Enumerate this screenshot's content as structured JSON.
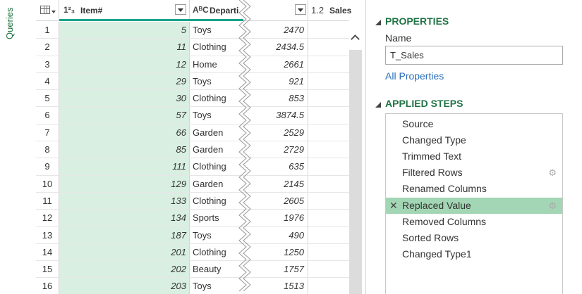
{
  "queries_rail": {
    "label": "Queries"
  },
  "grid": {
    "headers": {
      "item": {
        "type_icon": "1²₃",
        "label": "Item#"
      },
      "dept": {
        "type_icon": "AᴮC",
        "label": "Departi"
      },
      "sales": {
        "type_icon": "1.2",
        "label": "Sales"
      }
    },
    "rows": [
      {
        "n": "1",
        "item": "5",
        "dept": "Toys",
        "sales": "2470"
      },
      {
        "n": "2",
        "item": "11",
        "dept": "Clothing",
        "sales": "2434.5"
      },
      {
        "n": "3",
        "item": "12",
        "dept": "Home",
        "sales": "2661"
      },
      {
        "n": "4",
        "item": "29",
        "dept": "Toys",
        "sales": "921"
      },
      {
        "n": "5",
        "item": "30",
        "dept": "Clothing",
        "sales": "853"
      },
      {
        "n": "6",
        "item": "57",
        "dept": "Toys",
        "sales": "3874.5"
      },
      {
        "n": "7",
        "item": "66",
        "dept": "Garden",
        "sales": "2529"
      },
      {
        "n": "8",
        "item": "85",
        "dept": "Garden",
        "sales": "2729"
      },
      {
        "n": "9",
        "item": "111",
        "dept": "Clothing",
        "sales": "635"
      },
      {
        "n": "10",
        "item": "129",
        "dept": "Garden",
        "sales": "2145"
      },
      {
        "n": "11",
        "item": "133",
        "dept": "Clothing",
        "sales": "2605"
      },
      {
        "n": "12",
        "item": "134",
        "dept": "Sports",
        "sales": "1976"
      },
      {
        "n": "13",
        "item": "187",
        "dept": "Toys",
        "sales": "490"
      },
      {
        "n": "14",
        "item": "201",
        "dept": "Clothing",
        "sales": "1250"
      },
      {
        "n": "15",
        "item": "202",
        "dept": "Beauty",
        "sales": "1757"
      },
      {
        "n": "16",
        "item": "203",
        "dept": "Toys",
        "sales": "1513"
      }
    ]
  },
  "properties": {
    "title": "PROPERTIES",
    "name_label": "Name",
    "name_value": "T_Sales",
    "all_properties_link": "All Properties"
  },
  "applied_steps": {
    "title": "APPLIED STEPS",
    "steps": [
      {
        "label": "Source",
        "has_gear": false,
        "selected": false
      },
      {
        "label": "Changed Type",
        "has_gear": false,
        "selected": false
      },
      {
        "label": "Trimmed Text",
        "has_gear": false,
        "selected": false
      },
      {
        "label": "Filtered Rows",
        "has_gear": true,
        "selected": false
      },
      {
        "label": "Renamed Columns",
        "has_gear": false,
        "selected": false
      },
      {
        "label": "Replaced Value",
        "has_gear": true,
        "selected": true
      },
      {
        "label": "Removed Columns",
        "has_gear": false,
        "selected": false
      },
      {
        "label": "Sorted Rows",
        "has_gear": false,
        "selected": false
      },
      {
        "label": "Changed Type1",
        "has_gear": false,
        "selected": false
      }
    ]
  },
  "icons": {
    "table_menu": "table-icon",
    "column_filter": "dropdown-arrow-icon",
    "step_settings": "gear-icon",
    "step_delete": "close-icon",
    "scroll_up": "chevron-up-icon"
  },
  "colors": {
    "accent_green": "#217346",
    "teal_bar": "#1aa38a",
    "item_column_fill": "#d9efe2",
    "selected_step": "#a3d6b4",
    "link_blue": "#2a6ebb"
  }
}
